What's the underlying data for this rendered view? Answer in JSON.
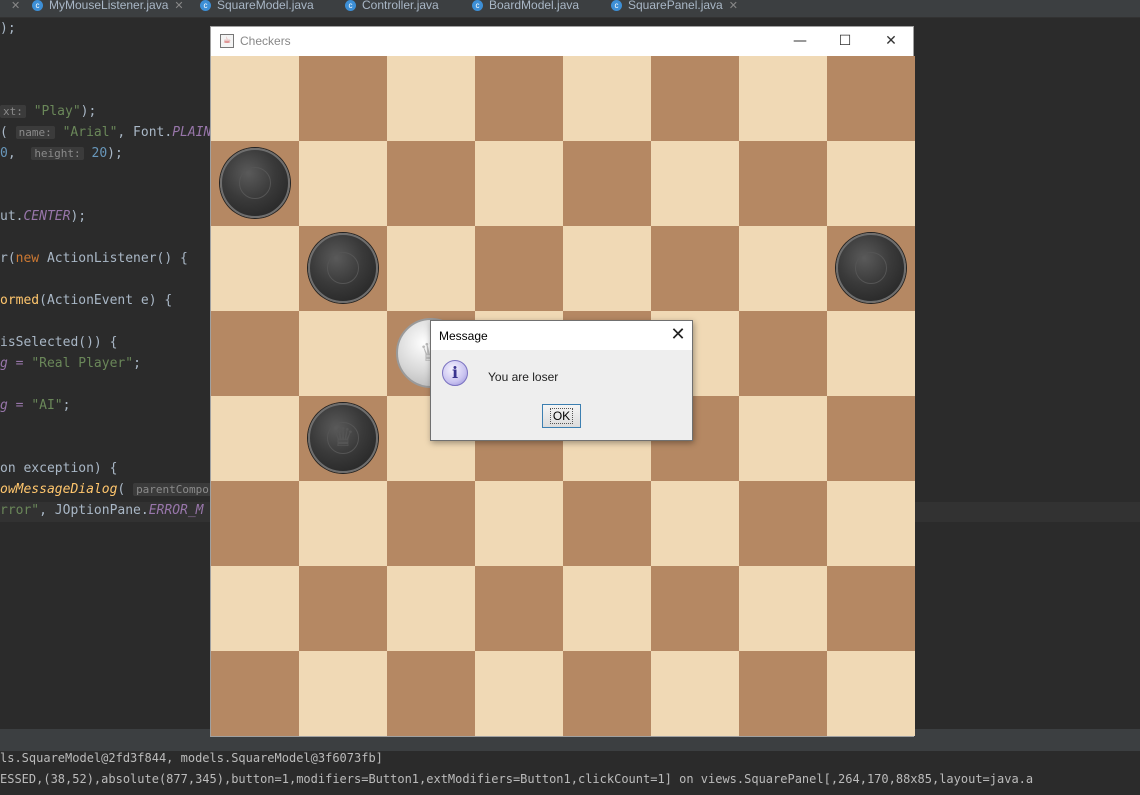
{
  "ide": {
    "tabs": [
      {
        "label": "MyMouseListener.java"
      },
      {
        "label": "SquareModel.java"
      },
      {
        "label": "Controller.java"
      },
      {
        "label": "BoardModel.java"
      },
      {
        "label": "SquarePanel.java"
      }
    ],
    "code": {
      "l1": ");",
      "l2_hint": "xt:",
      "l2_str": "\"Play\"",
      "l2_end": ");",
      "l3_open": "(",
      "l3_hint": "name:",
      "l3_str": "\"Arial\"",
      "l3_mid": ", Font.",
      "l3_const": "PLAIN",
      "l3_end": ",",
      "l4_num0": "0",
      "l4_mid": ",",
      "l4_hint": "height:",
      "l4_num": "20",
      "l4_end": ");",
      "l5_pre": "ut.",
      "l5_const": "CENTER",
      "l5_end": ");",
      "l6_pre": "r(",
      "l6_kw": "new",
      "l6_rest": " ActionListener() {",
      "l7_meth": "ormed",
      "l7_rest": "(ActionEvent e) {",
      "l8": "isSelected()) {",
      "l9_pre": "g = ",
      "l9_str": "\"Real Player\"",
      "l9_end": ";",
      "l10_pre": "g = ",
      "l10_str": "\"AI\"",
      "l10_end": ";",
      "l11": "on exception) {",
      "l12_meth": "owMessageDialog",
      "l12_open": "(",
      "l12_hint": "parentCompor",
      "l13_str": "rror\"",
      "l13_mid": ", JOptionPane.",
      "l13_const": "ERROR_M"
    },
    "console": {
      "line1": "ls.SquareModel@2fd3f844, models.SquareModel@3f6073fb]",
      "line2": "ESSED,(38,52),absolute(877,345),button=1,modifiers=Button1,extModifiers=Button1,clickCount=1] on views.SquarePanel[,264,170,88x85,layout=java.a"
    }
  },
  "window": {
    "title": "Checkers",
    "icon": "java-cup-icon",
    "buttons": {
      "minimize": "—",
      "maximize": "☐",
      "close": "✕"
    }
  },
  "board": {
    "size": 8,
    "light_color": "#f0d9b5",
    "dark_color": "#b58863",
    "pieces": [
      {
        "row": 1,
        "col": 0,
        "color": "black",
        "king": false
      },
      {
        "row": 2,
        "col": 1,
        "color": "black",
        "king": false
      },
      {
        "row": 2,
        "col": 7,
        "color": "black",
        "king": false
      },
      {
        "row": 3,
        "col": 2,
        "color": "white",
        "king": true
      },
      {
        "row": 4,
        "col": 1,
        "color": "black",
        "king": true
      }
    ]
  },
  "dialog": {
    "title": "Message",
    "message": "You are loser",
    "ok_label": "OK",
    "close_glyph": "✕",
    "icon": "information-icon"
  }
}
